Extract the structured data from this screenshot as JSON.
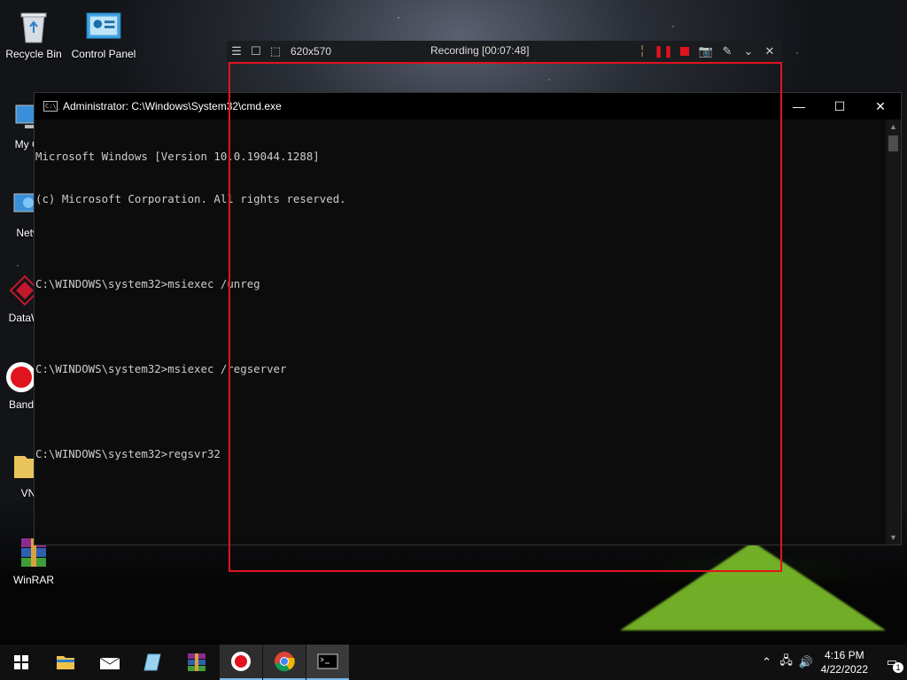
{
  "desktop": {
    "icons": [
      {
        "label": "Recycle Bin",
        "icon": "recycle-bin-icon"
      },
      {
        "label": "Control Panel",
        "icon": "control-panel-icon"
      },
      {
        "label": "My Co",
        "icon": "computer-icon"
      },
      {
        "label": "Netw",
        "icon": "network-icon"
      },
      {
        "label": "DataW",
        "icon": "datawrapper-icon"
      },
      {
        "label": "Band",
        "icon": "bandicam-icon"
      },
      {
        "label": "VN",
        "icon": "folder-icon"
      },
      {
        "label": "WinRAR",
        "icon": "winrar-icon"
      }
    ]
  },
  "recorder": {
    "size": "620x570",
    "title": "Recording [00:07:48]",
    "accent": "#e0141e"
  },
  "cmd": {
    "title": "Administrator: C:\\Windows\\System32\\cmd.exe",
    "icon_text": "C:\\_",
    "lines": [
      "Microsoft Windows [Version 10.0.19044.1288]",
      "(c) Microsoft Corporation. All rights reserved.",
      "",
      "C:\\WINDOWS\\system32>msiexec /unreg",
      "",
      "C:\\WINDOWS\\system32>msiexec /regserver",
      "",
      "C:\\WINDOWS\\system32>regsvr32"
    ]
  },
  "taskbar": {
    "time": "4:16 PM",
    "date": "4/22/2022",
    "notification_count": "1",
    "items": [
      "start-icon",
      "file-explorer-icon",
      "mail-icon",
      "notepad-icon",
      "winrar-icon",
      "bandicam-icon",
      "chrome-icon",
      "cmd-icon"
    ]
  }
}
